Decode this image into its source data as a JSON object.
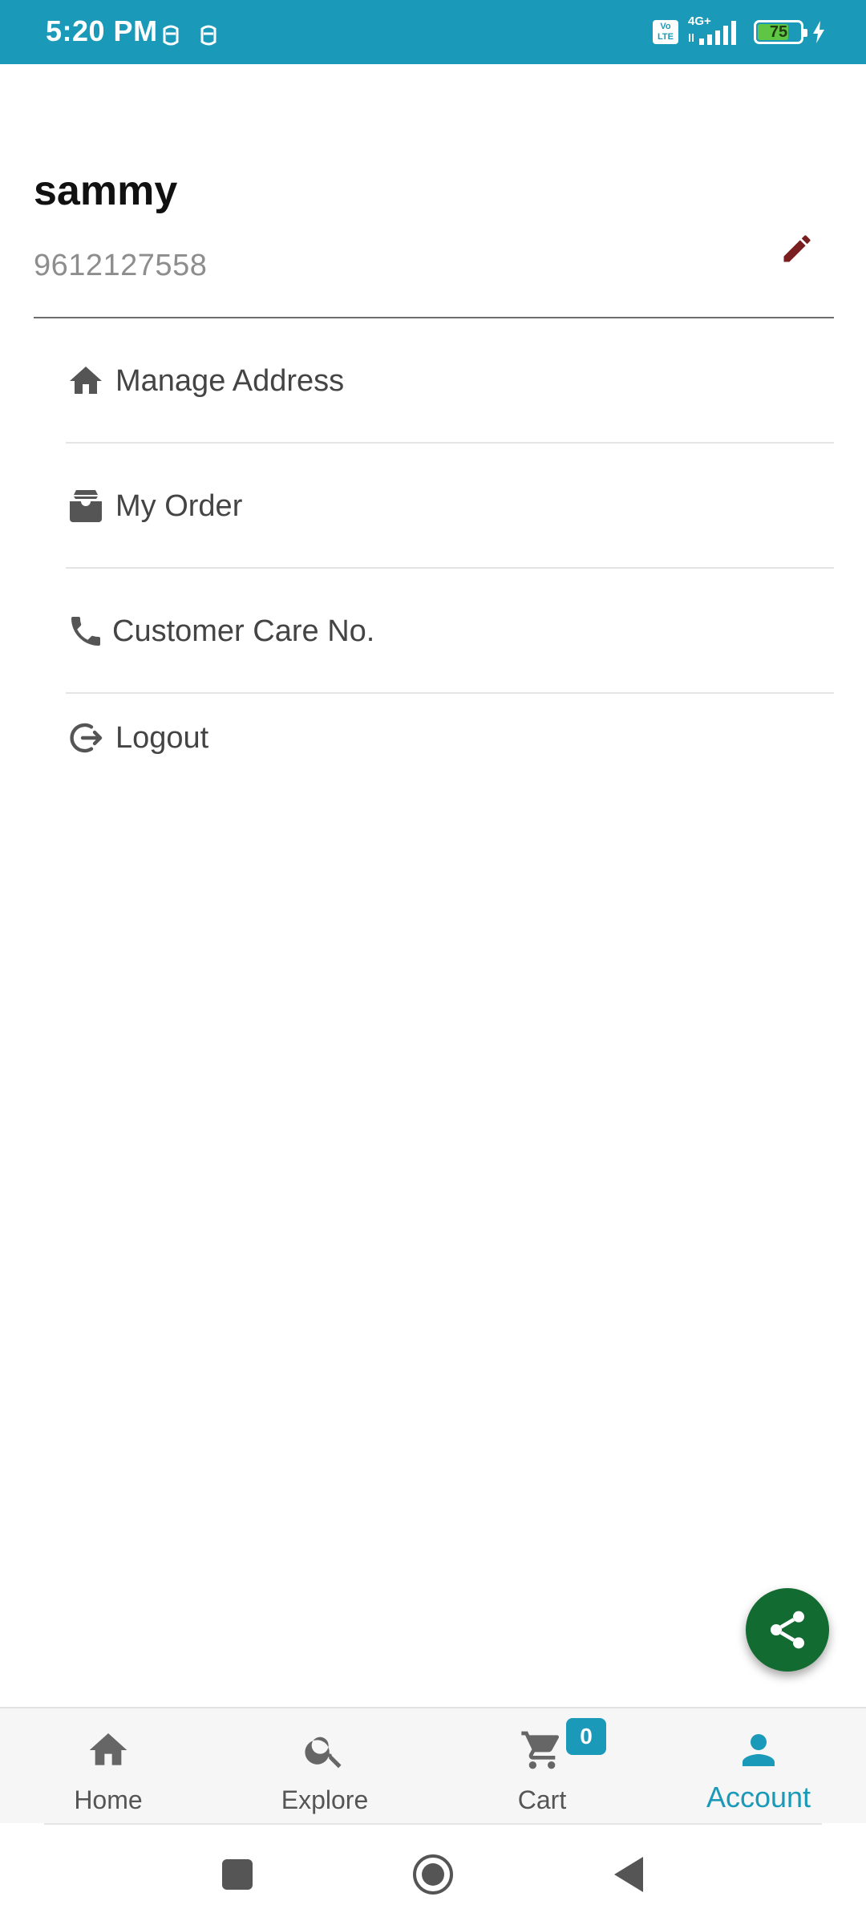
{
  "status_bar": {
    "time": "5:20 PM",
    "network": "4G+",
    "volte": "Vo LTE",
    "battery": "75",
    "battery_level": 0.75,
    "icons": [
      "notification-icon",
      "notification-icon",
      "volte-icon",
      "signal-icon",
      "battery-icon",
      "charging-icon"
    ]
  },
  "profile": {
    "name": "sammy",
    "phone": "9612127558",
    "edit_icon": "pencil-icon"
  },
  "menu": {
    "items": [
      {
        "label": "Manage Address",
        "icon": "home-icon"
      },
      {
        "label": "My Order",
        "icon": "inbox-icon"
      },
      {
        "label": "Customer Care No.",
        "icon": "phone-icon"
      },
      {
        "label": "Logout",
        "icon": "logout-icon"
      }
    ]
  },
  "fab": {
    "icon": "share-icon"
  },
  "bottom_nav": {
    "items": [
      {
        "label": "Home",
        "icon": "home-icon"
      },
      {
        "label": "Explore",
        "icon": "search-icon"
      },
      {
        "label": "Cart",
        "icon": "cart-icon"
      },
      {
        "label": "Account",
        "icon": "person-icon"
      }
    ],
    "active": "Account",
    "cart_count": "0"
  },
  "colors": {
    "accent": "#1a9ab8",
    "edit_icon": "#7a1f1f",
    "fab": "#126b31",
    "battery_fill": "#5ec545"
  }
}
